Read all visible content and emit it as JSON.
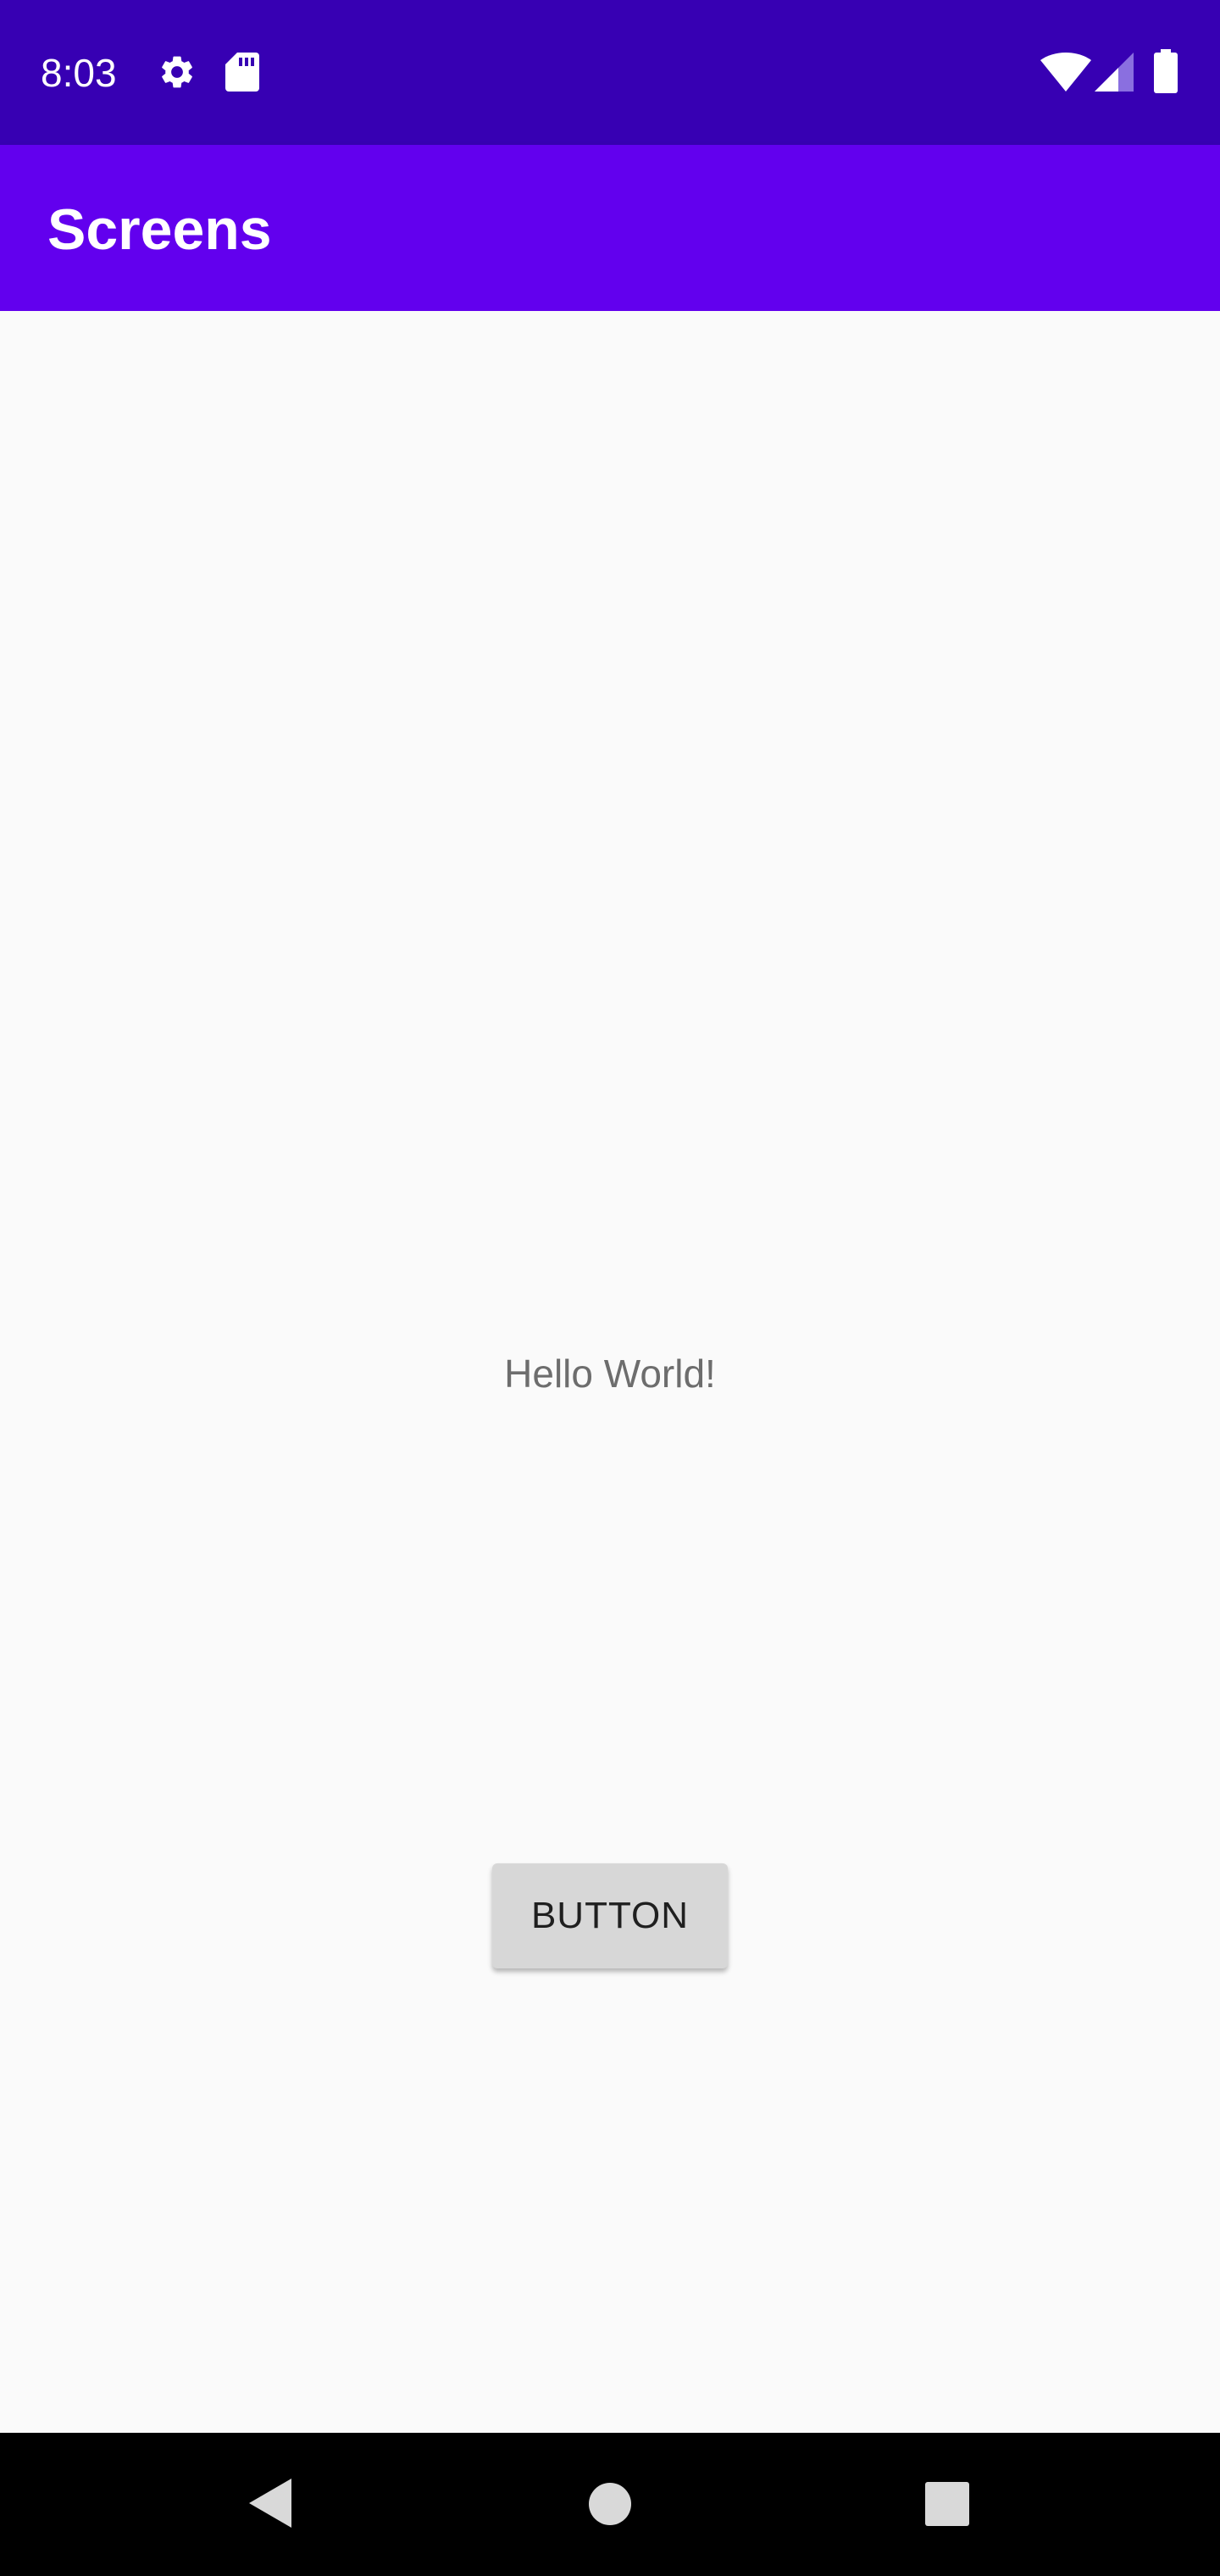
{
  "status_bar": {
    "time": "8:03",
    "icons": [
      "gear-icon",
      "sd-card-icon",
      "wifi-icon",
      "cell-signal-icon",
      "battery-icon"
    ],
    "background": "#3700b3"
  },
  "app_bar": {
    "title": "Screens",
    "background": "#6200ee"
  },
  "main": {
    "hello_text": "Hello World!",
    "button_label": "BUTTON",
    "background": "#fafafa"
  },
  "nav_bar": {
    "buttons": [
      "back-icon",
      "home-icon",
      "recents-icon"
    ],
    "background": "#000000"
  }
}
